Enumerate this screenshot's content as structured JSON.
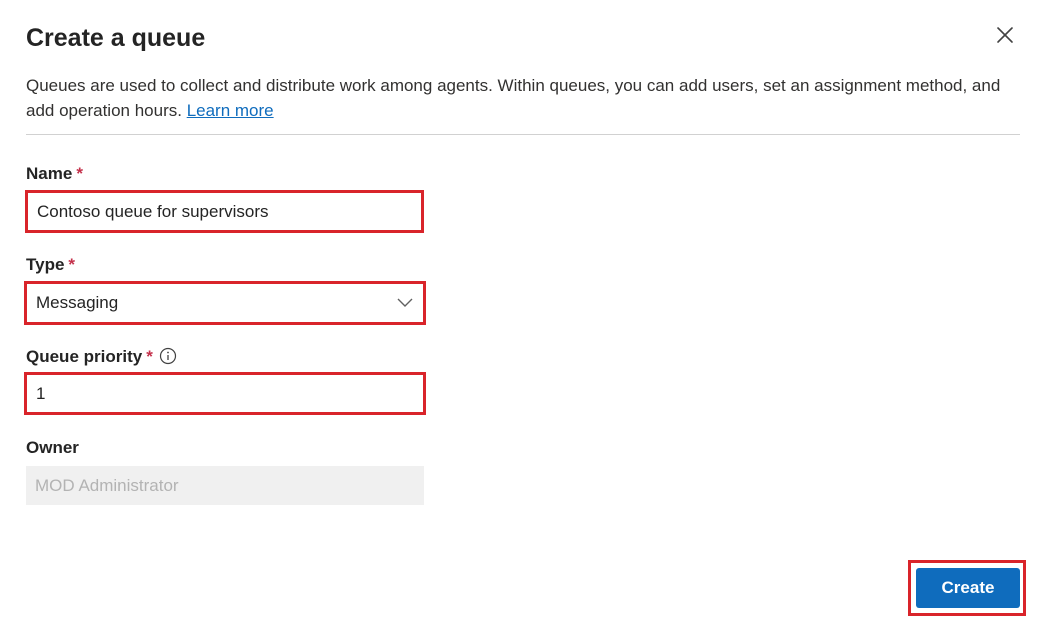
{
  "dialog": {
    "title": "Create a queue",
    "close_icon": "close-icon",
    "description": "Queues are used to collect and distribute work among agents. Within queues, you can add users, set an assignment method, and add operation hours.",
    "learn_more_label": "Learn more"
  },
  "form": {
    "name": {
      "label": "Name",
      "required_mark": "*",
      "value": "Contoso queue for supervisors"
    },
    "type": {
      "label": "Type",
      "required_mark": "*",
      "selected": "Messaging",
      "icon": "chevron-down-icon"
    },
    "priority": {
      "label": "Queue priority",
      "required_mark": "*",
      "info_icon": "info-icon",
      "value": "1"
    },
    "owner": {
      "label": "Owner",
      "value": "MOD Administrator"
    }
  },
  "actions": {
    "create_label": "Create"
  },
  "colors": {
    "accent": "#0f6cbd",
    "highlight": "#d9242a",
    "required": "#c4314b",
    "disabled_bg": "#f0f0f0"
  }
}
